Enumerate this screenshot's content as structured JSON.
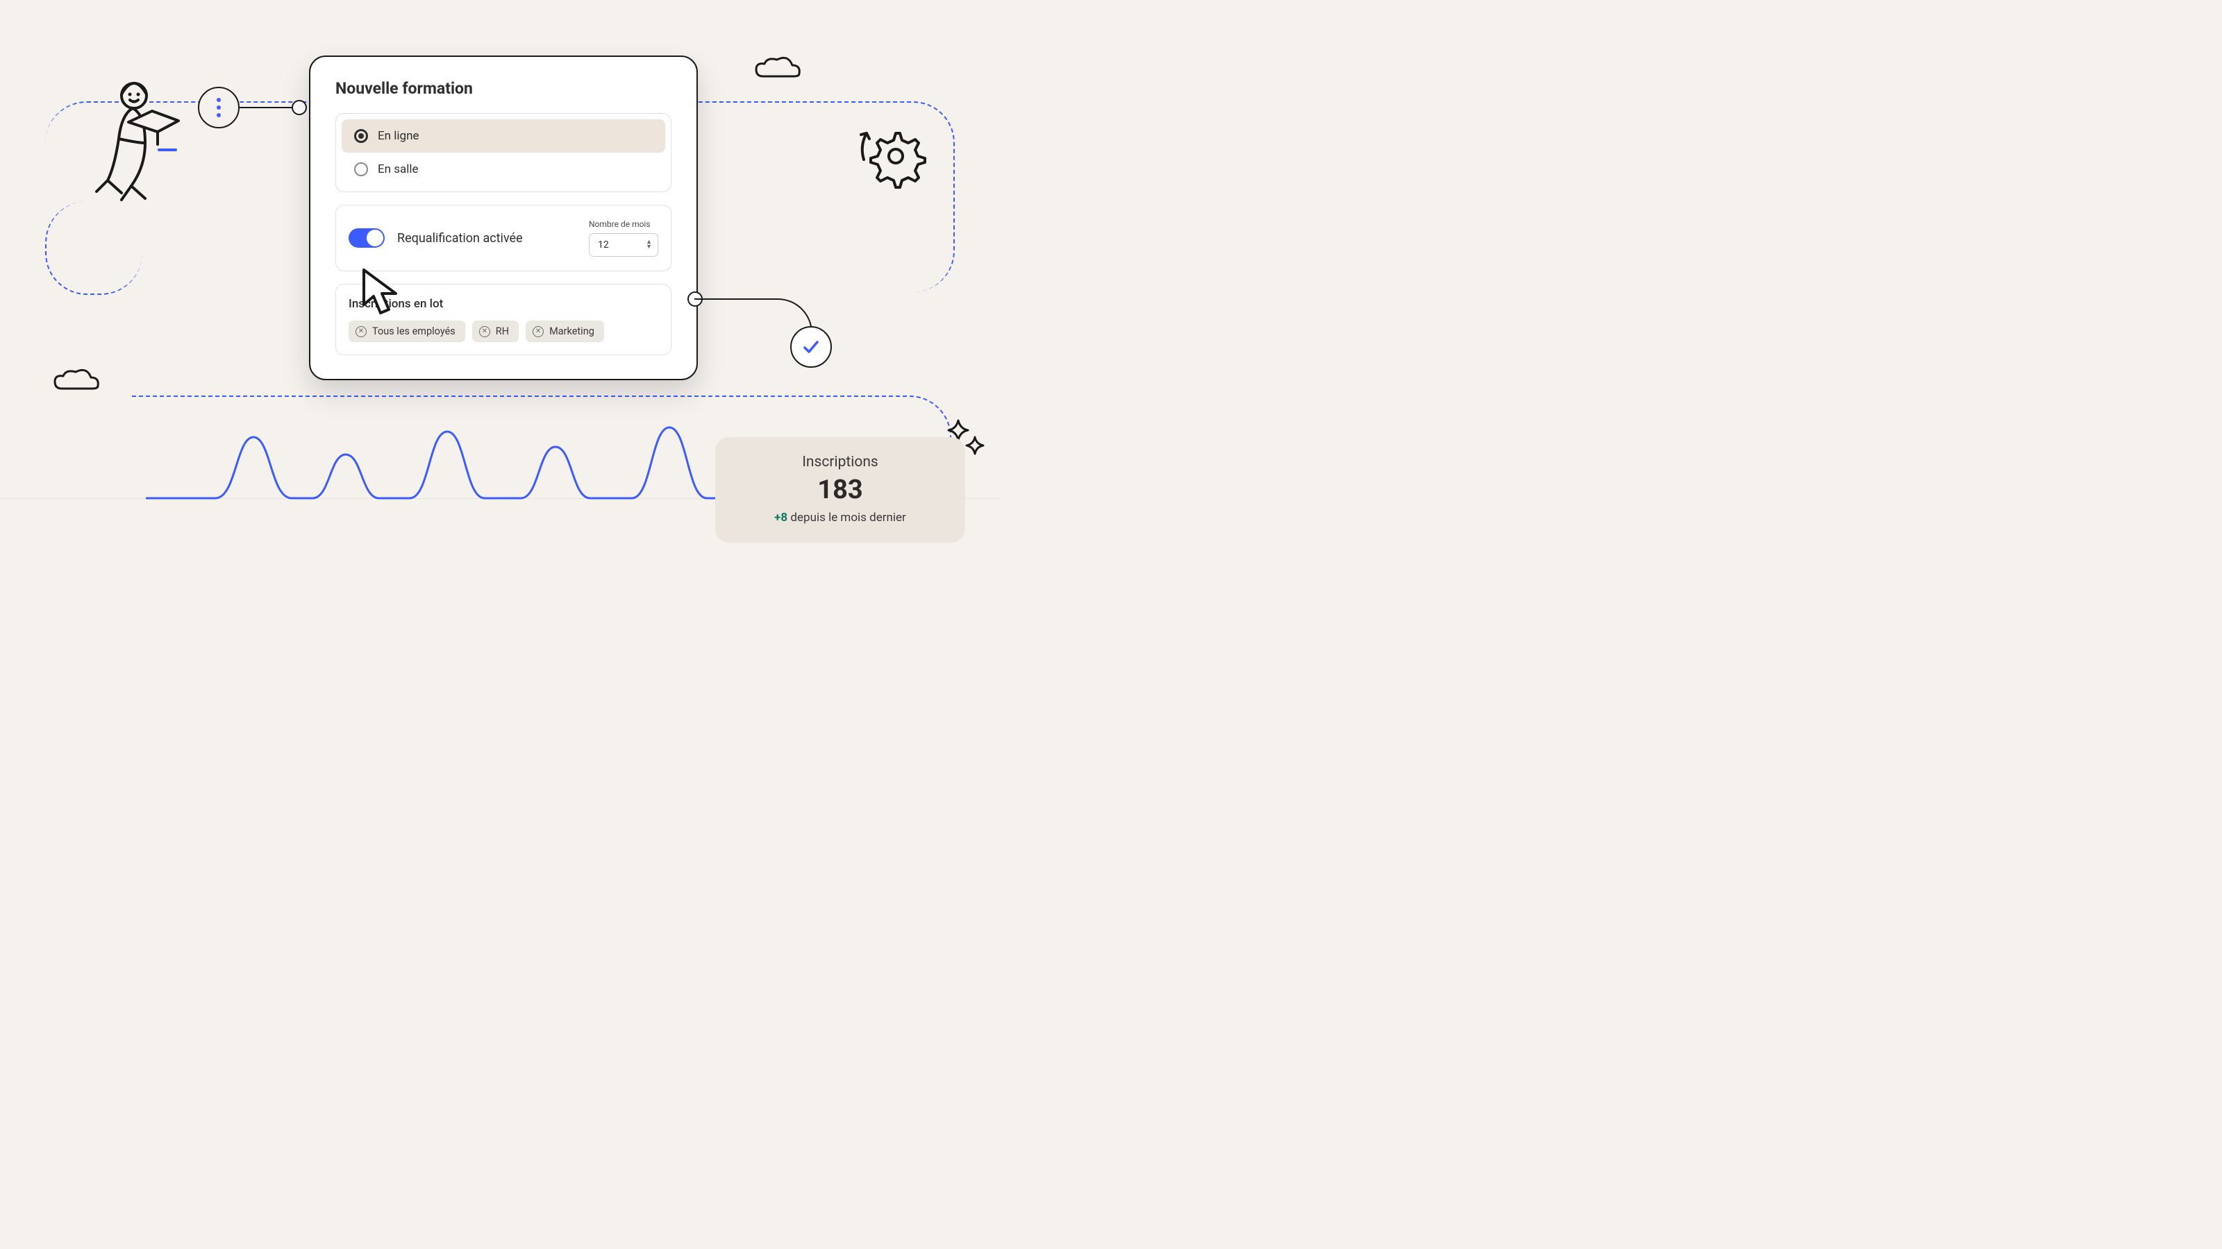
{
  "card": {
    "title": "Nouvelle formation",
    "mode_options": [
      {
        "label": "En ligne",
        "selected": true
      },
      {
        "label": "En salle",
        "selected": false
      }
    ],
    "requal": {
      "label": "Requalification activée",
      "enabled": true,
      "months_label": "Nombre de mois",
      "months_value": "12"
    },
    "bulk": {
      "title": "Inscriptions en lot",
      "tags": [
        "Tous les employés",
        "RH",
        "Marketing"
      ]
    }
  },
  "stats": {
    "title": "Inscriptions",
    "value": "183",
    "delta_prefix": "+8",
    "delta_suffix": " depuis le mois dernier"
  },
  "colors": {
    "accent": "#3b5bff",
    "delta_positive": "#0e7a5f"
  }
}
